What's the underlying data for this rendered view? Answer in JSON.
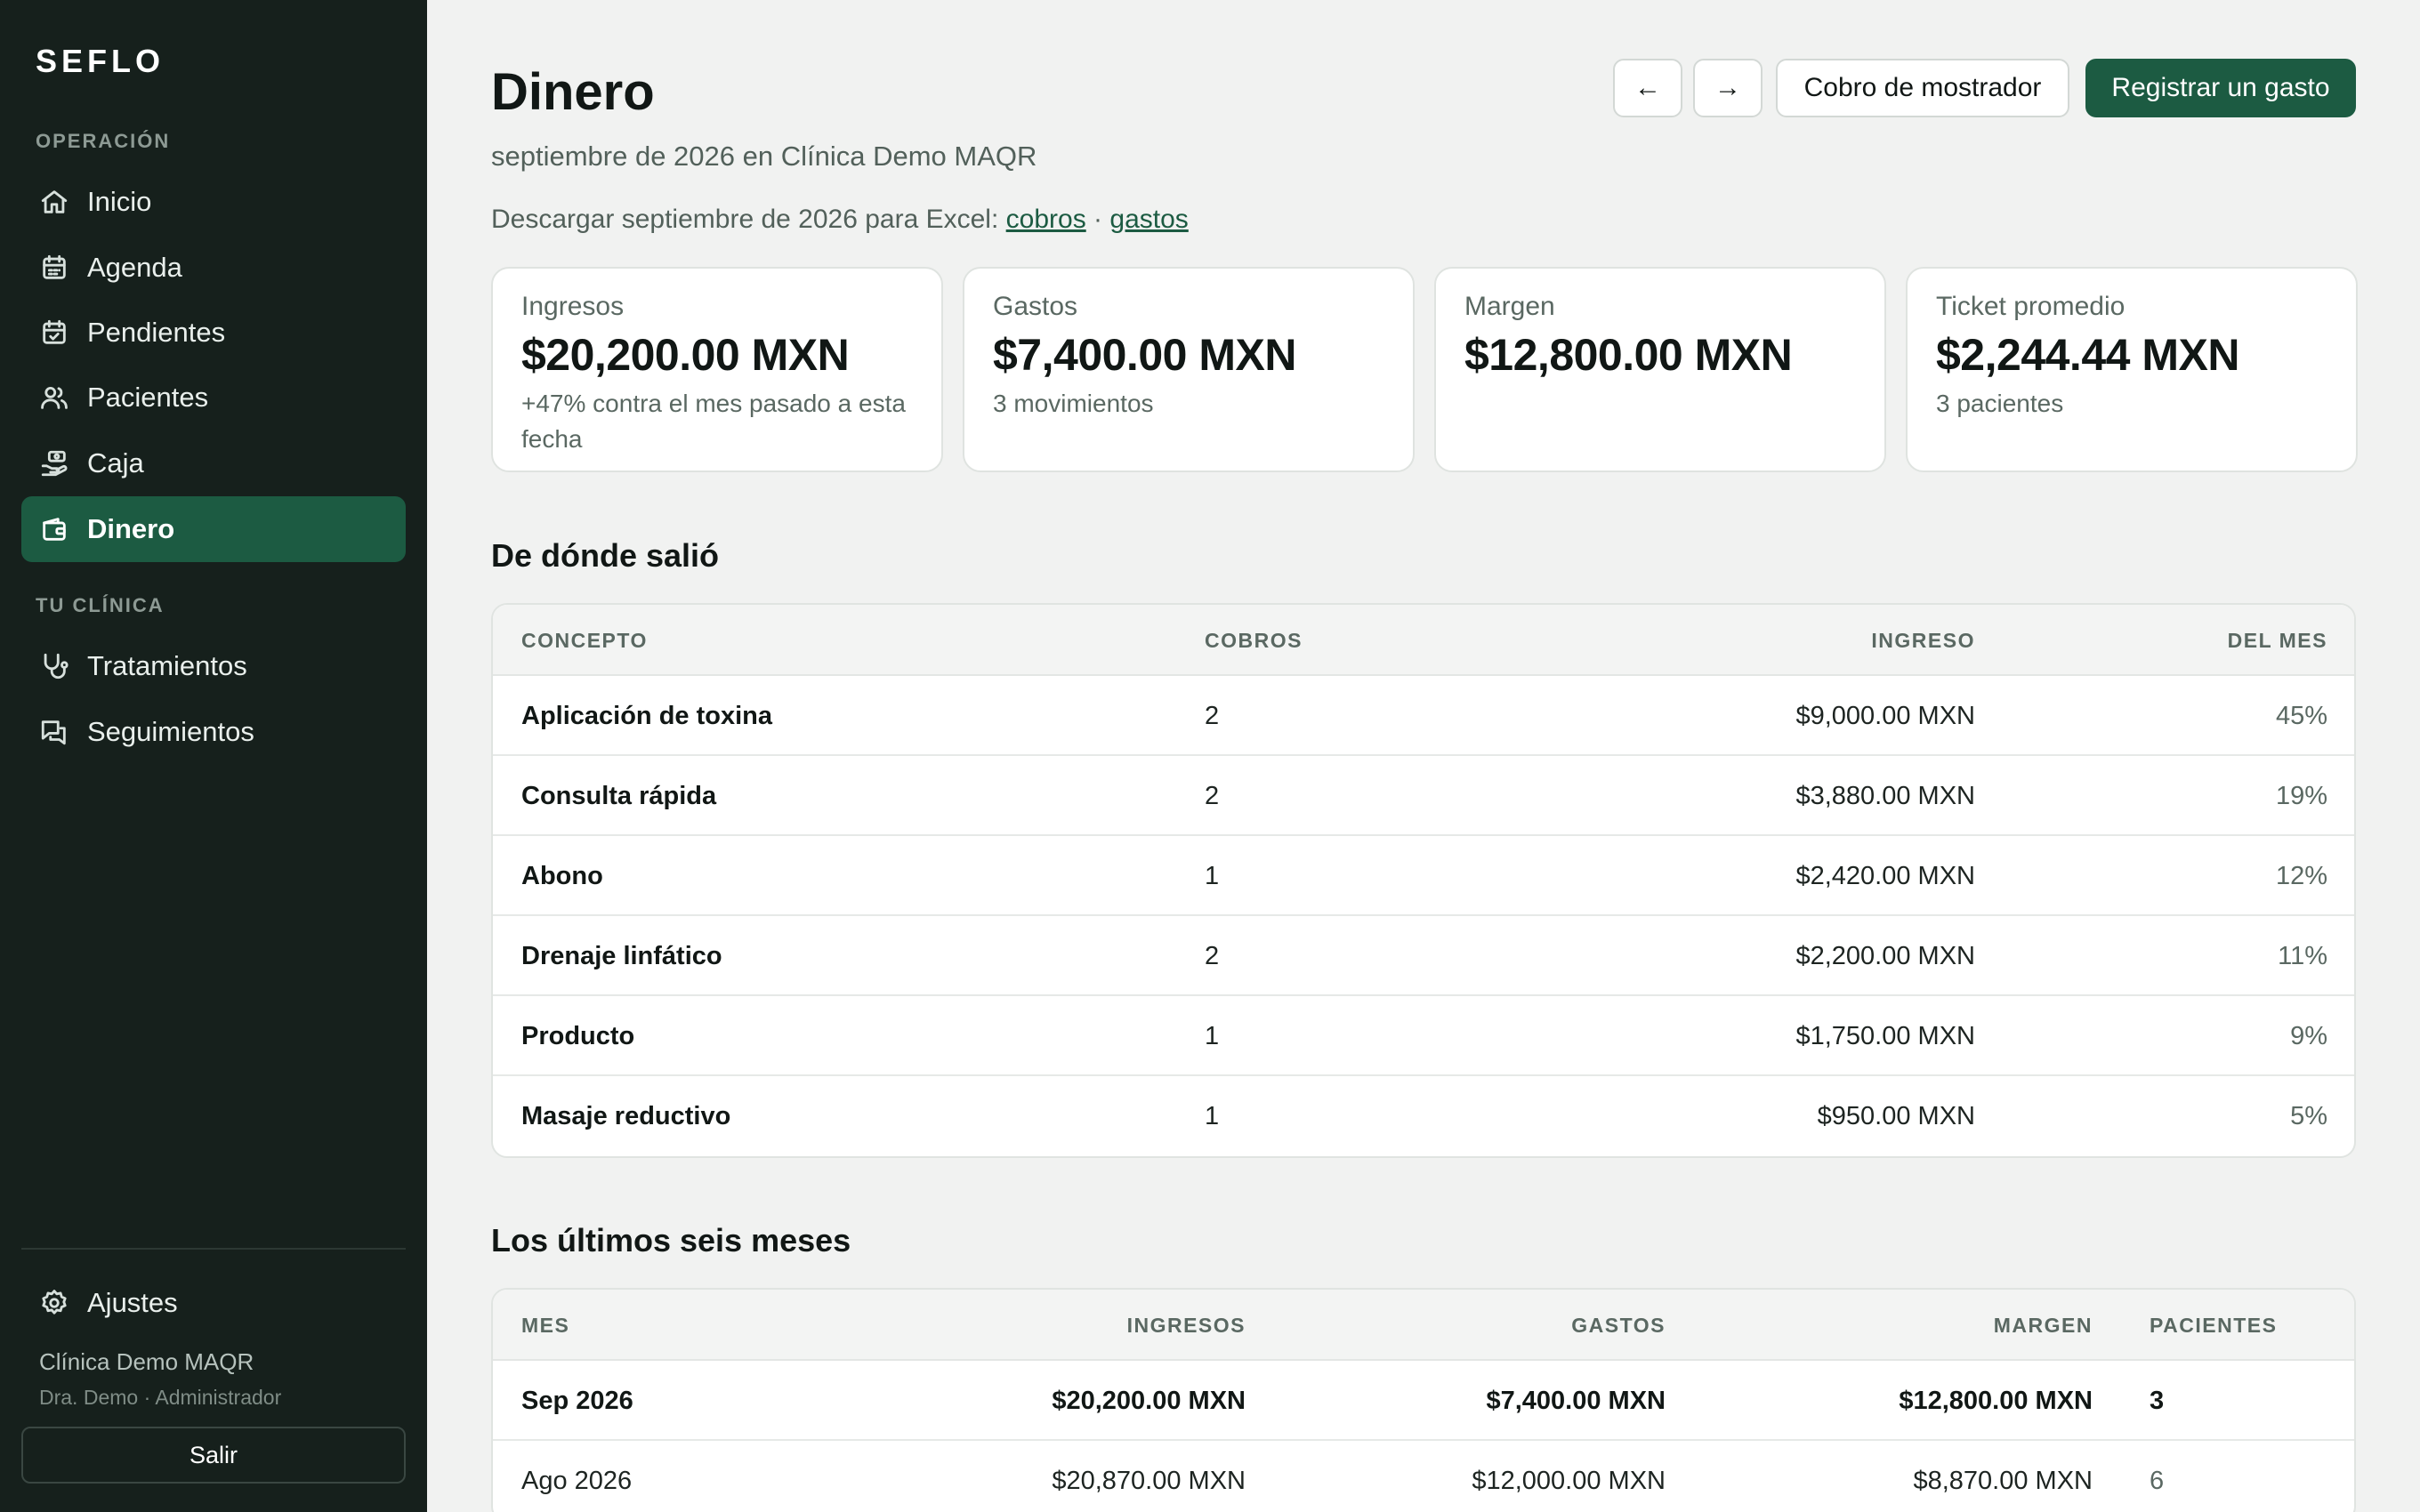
{
  "brand": "SEFLO",
  "sidebar": {
    "section_operation": "OPERACIÓN",
    "section_clinic": "TU CLÍNICA",
    "items": [
      {
        "label": "Inicio",
        "icon": "home-icon"
      },
      {
        "label": "Agenda",
        "icon": "calendar-icon"
      },
      {
        "label": "Pendientes",
        "icon": "calendar-check-icon"
      },
      {
        "label": "Pacientes",
        "icon": "users-icon"
      },
      {
        "label": "Caja",
        "icon": "cash-hand-icon"
      },
      {
        "label": "Dinero",
        "icon": "wallet-icon",
        "active": true
      },
      {
        "label": "Tratamientos",
        "icon": "stethoscope-icon"
      },
      {
        "label": "Seguimientos",
        "icon": "chat-icon"
      }
    ],
    "settings_label": "Ajustes",
    "clinic_name": "Clínica Demo MAQR",
    "user_line": "Dra. Demo · Administrador",
    "logout_label": "Salir"
  },
  "header": {
    "title": "Dinero",
    "subtitle": "septiembre de 2026 en Clínica Demo MAQR",
    "prev_label": "←",
    "next_label": "→",
    "counter_charge_label": "Cobro de mostrador",
    "register_expense_label": "Registrar un gasto",
    "export_prefix": "Descargar septiembre de 2026 para Excel:",
    "export_charges": "cobros",
    "export_separator": "·",
    "export_expenses": "gastos"
  },
  "kpis": [
    {
      "label": "Ingresos",
      "value": "$20,200.00 MXN",
      "note": "+47% contra el mes pasado a esta fecha"
    },
    {
      "label": "Gastos",
      "value": "$7,400.00 MXN",
      "note": "3 movimientos"
    },
    {
      "label": "Margen",
      "value": "$12,800.00 MXN",
      "note": ""
    },
    {
      "label": "Ticket promedio",
      "value": "$2,244.44 MXN",
      "note": "3 pacientes"
    }
  ],
  "sources": {
    "title": "De dónde salió",
    "headers": {
      "concept": "CONCEPTO",
      "charges": "COBROS",
      "income": "INGRESO",
      "share": "DEL MES"
    },
    "rows": [
      {
        "concept": "Aplicación de toxina",
        "charges": "2",
        "income": "$9,000.00 MXN",
        "share": "45%"
      },
      {
        "concept": "Consulta rápida",
        "charges": "2",
        "income": "$3,880.00 MXN",
        "share": "19%"
      },
      {
        "concept": "Abono",
        "charges": "1",
        "income": "$2,420.00 MXN",
        "share": "12%"
      },
      {
        "concept": "Drenaje linfático",
        "charges": "2",
        "income": "$2,200.00 MXN",
        "share": "11%"
      },
      {
        "concept": "Producto",
        "charges": "1",
        "income": "$1,750.00 MXN",
        "share": "9%"
      },
      {
        "concept": "Masaje reductivo",
        "charges": "1",
        "income": "$950.00 MXN",
        "share": "5%"
      }
    ]
  },
  "months": {
    "title": "Los últimos seis meses",
    "headers": {
      "month": "MES",
      "income": "INGRESOS",
      "expenses": "GASTOS",
      "margin": "MARGEN",
      "patients": "PACIENTES"
    },
    "rows": [
      {
        "month": "Sep 2026",
        "income": "$20,200.00 MXN",
        "expenses": "$7,400.00 MXN",
        "margin": "$12,800.00 MXN",
        "patients": "3",
        "current": true
      },
      {
        "month": "Ago 2026",
        "income": "$20,870.00 MXN",
        "expenses": "$12,000.00 MXN",
        "margin": "$8,870.00 MXN",
        "patients": "6",
        "current": false
      }
    ]
  }
}
